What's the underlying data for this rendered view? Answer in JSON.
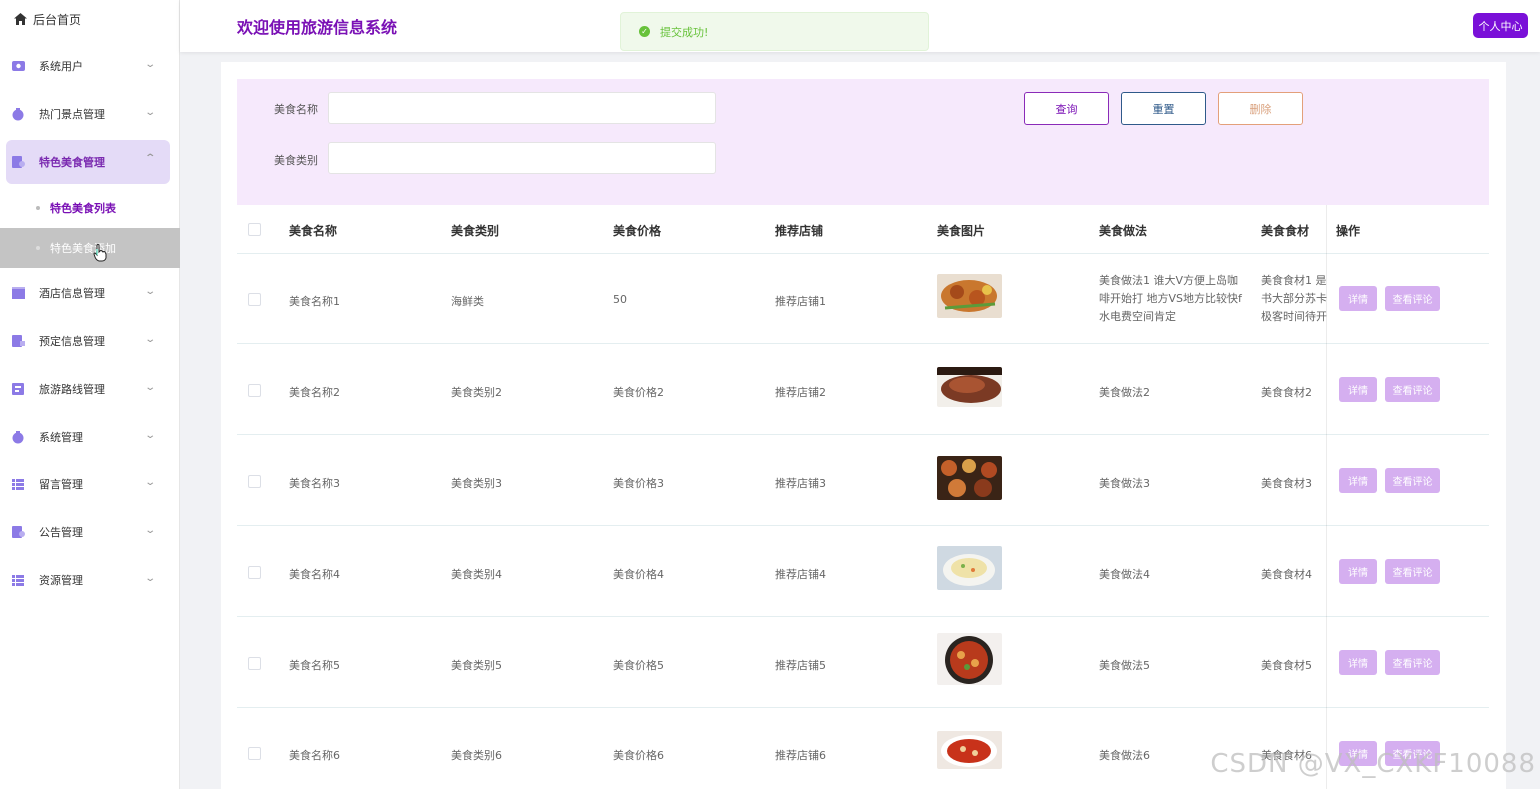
{
  "sidebar": {
    "home_label": "后台首页",
    "items": [
      {
        "label": "系统用户",
        "icon": "user-icon"
      },
      {
        "label": "热门景点管理",
        "icon": "location-icon"
      },
      {
        "label": "特色美食管理",
        "icon": "food-icon"
      },
      {
        "label": "酒店信息管理",
        "icon": "hotel-icon"
      },
      {
        "label": "预定信息管理",
        "icon": "booking-icon"
      },
      {
        "label": "旅游路线管理",
        "icon": "route-icon"
      },
      {
        "label": "系统管理",
        "icon": "settings-icon"
      },
      {
        "label": "留言管理",
        "icon": "message-icon"
      },
      {
        "label": "公告管理",
        "icon": "notice-icon"
      },
      {
        "label": "资源管理",
        "icon": "resource-icon"
      }
    ],
    "sub_items": [
      {
        "label": "特色美食列表"
      },
      {
        "label": "特色美食添加"
      }
    ]
  },
  "header": {
    "title": "欢迎使用旅游信息系统",
    "toast": "提交成功!",
    "profile_button": "个人中心"
  },
  "search": {
    "name_label": "美食名称",
    "type_label": "美食类别",
    "query_button": "查询",
    "reset_button": "重置",
    "delete_button": "删除"
  },
  "table": {
    "columns": [
      "美食名称",
      "美食类别",
      "美食价格",
      "推荐店铺",
      "美食图片",
      "美食做法",
      "美食食材",
      "操作"
    ],
    "rows": [
      {
        "name": "美食名称1",
        "type": "海鲜类",
        "price": "50",
        "shop": "推荐店铺1",
        "method": "美食做法1 谁大V方便上岛咖啡开始打 地方VS地方比较快f水电费空间肯定",
        "ingredients": "美食食材1 是书大部分苏卡极客时间待开"
      },
      {
        "name": "美食名称2",
        "type": "美食类别2",
        "price": "美食价格2",
        "shop": "推荐店铺2",
        "method": "美食做法2",
        "ingredients": "美食食材2"
      },
      {
        "name": "美食名称3",
        "type": "美食类别3",
        "price": "美食价格3",
        "shop": "推荐店铺3",
        "method": "美食做法3",
        "ingredients": "美食食材3"
      },
      {
        "name": "美食名称4",
        "type": "美食类别4",
        "price": "美食价格4",
        "shop": "推荐店铺4",
        "method": "美食做法4",
        "ingredients": "美食食材4"
      },
      {
        "name": "美食名称5",
        "type": "美食类别5",
        "price": "美食价格5",
        "shop": "推荐店铺5",
        "method": "美食做法5",
        "ingredients": "美食食材5"
      },
      {
        "name": "美食名称6",
        "type": "美食类别6",
        "price": "美食价格6",
        "shop": "推荐店铺6",
        "method": "美食做法6",
        "ingredients": "美食食材6"
      }
    ],
    "detail_button": "详情",
    "review_button": "查看评论"
  },
  "watermark": "CSDN @VX_CXKF10088",
  "colors": {
    "accent": "#7a10b5",
    "search_bg": "#f6e9fc",
    "op_button": "#d5aff0",
    "success": "#67c23a"
  }
}
